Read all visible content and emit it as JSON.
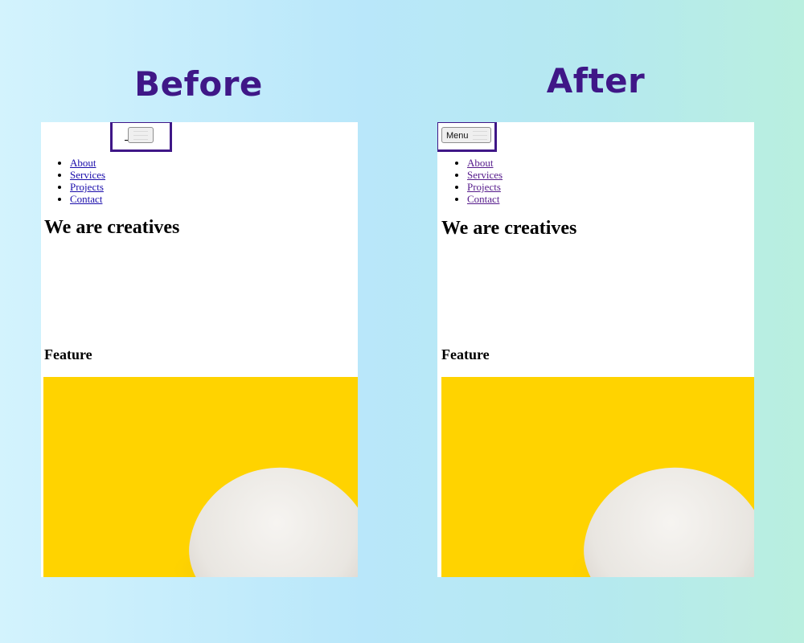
{
  "captions": {
    "before": "Before",
    "after": "After"
  },
  "colors": {
    "caption": "#3f1787",
    "highlight_border": "#3f1787",
    "image_background": "#ffd300",
    "link_before": "#1a0dab",
    "link_after": "#551a8b"
  },
  "before_panel": {
    "menu_button_label": "",
    "nav": [
      "About",
      "Services",
      "Projects",
      "Contact"
    ],
    "hero_heading": "We are creatives",
    "feature_heading": "Feature",
    "image_icon": "yellow-egg-photo"
  },
  "after_panel": {
    "menu_button_label": "Menu",
    "nav": [
      "About",
      "Services",
      "Projects",
      "Contact"
    ],
    "hero_heading": "We are creatives",
    "feature_heading": "Feature",
    "image_icon": "yellow-egg-photo"
  }
}
